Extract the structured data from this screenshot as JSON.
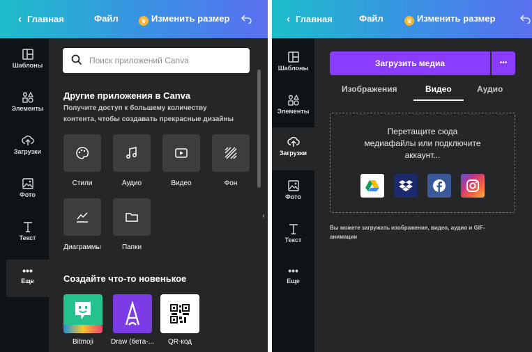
{
  "left": {
    "topbar": {
      "home": "Главная",
      "file": "Файл",
      "resize": "Изменить размер"
    },
    "sidebar": [
      {
        "label": "Шаблоны",
        "icon": "templates-icon"
      },
      {
        "label": "Элементы",
        "icon": "elements-icon"
      },
      {
        "label": "Загрузки",
        "icon": "upload-icon"
      },
      {
        "label": "Фото",
        "icon": "photo-icon"
      },
      {
        "label": "Текст",
        "icon": "text-icon"
      },
      {
        "label": "Еще",
        "icon": "more-icon"
      }
    ],
    "search": {
      "placeholder": "Поиск приложений Canva"
    },
    "other_apps": {
      "title": "Другие приложения в Canva",
      "subtitle_line1": "Получите доступ к большему количеству",
      "subtitle_line2": "контента, чтобы создавать прекрасные дизайны",
      "tiles": [
        "Стили",
        "Аудио",
        "Видео",
        "Фон",
        "Диаграммы",
        "Папки"
      ]
    },
    "new_section": {
      "title": "Создайте что-то новенькое",
      "apps": [
        "Bitmoji",
        "Draw (бета-...",
        "QR-код"
      ]
    }
  },
  "right": {
    "topbar": {
      "home": "Главная",
      "file": "Файл",
      "resize": "Изменить размер"
    },
    "sidebar": [
      {
        "label": "Шаблоны",
        "icon": "templates-icon"
      },
      {
        "label": "Элементы",
        "icon": "elements-icon"
      },
      {
        "label": "Загрузки",
        "icon": "upload-icon"
      },
      {
        "label": "Фото",
        "icon": "photo-icon"
      },
      {
        "label": "Текст",
        "icon": "text-icon"
      },
      {
        "label": "Еще",
        "icon": "more-icon"
      }
    ],
    "upload_button": "Загрузить медиа",
    "more_button": "•••",
    "tabs": [
      "Изображения",
      "Видео",
      "Аудио"
    ],
    "active_tab": "Видео",
    "dropzone": {
      "line1": "Перетащите сюда",
      "line2": "медиафайлы или подключите",
      "line3": "аккаунт..."
    },
    "services": [
      "google-drive-icon",
      "dropbox-icon",
      "facebook-icon",
      "instagram-icon"
    ],
    "hint_line1": "Вы можете загружать изображения, видео, аудио и GIF-",
    "hint_line2": "анимации"
  },
  "colors": {
    "accent_purple": "#8b3dff",
    "dark_panel": "#252627",
    "sidebar": "#0e1318"
  }
}
